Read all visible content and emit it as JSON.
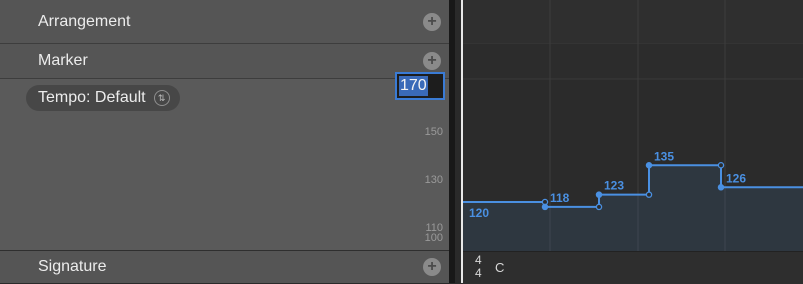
{
  "tracks": {
    "arrangement": {
      "label": "Arrangement"
    },
    "marker": {
      "label": "Marker"
    },
    "tempo": {
      "dropdown_label": "Tempo: Default",
      "edit_value": "170",
      "ticks": [
        "150",
        "130",
        "110",
        "100"
      ]
    },
    "signature": {
      "label": "Signature",
      "numerator": "4",
      "denominator": "4",
      "key": "C"
    }
  },
  "tempo_curve": {
    "points": [
      {
        "tempo": 120,
        "label": "120"
      },
      {
        "tempo": 118,
        "label": "118"
      },
      {
        "tempo": 123,
        "label": "123"
      },
      {
        "tempo": 135,
        "label": "135"
      },
      {
        "tempo": 126,
        "label": "126"
      }
    ]
  },
  "colors": {
    "accent": "#3a7bd5",
    "curve": "#4a90e2",
    "panel": "#5a5a5a",
    "timeline_bg": "#2b2b2b"
  }
}
